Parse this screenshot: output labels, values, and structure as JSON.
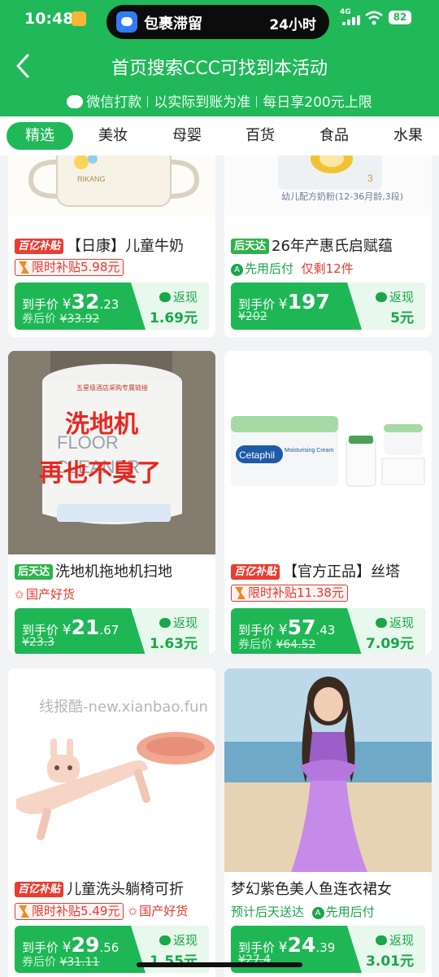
{
  "status": {
    "time": "10:48",
    "island_text": "包裹滞留",
    "island_right": "24小时",
    "network": "4G",
    "battery": "82"
  },
  "header": {
    "title": "首页搜索CCC可找到本活动",
    "subbar": [
      "微信打款",
      "以实际到账为准",
      "每日享200元上限"
    ]
  },
  "tabs": [
    "精选",
    "美妆",
    "母婴",
    "百货",
    "食品",
    "水果"
  ],
  "labels": {
    "subsidy_tag": "百亿补贴",
    "fast_tag": "后天达",
    "final_price": "到手价",
    "after_coupon": "券后价",
    "cashback": "返现",
    "yen": "¥",
    "cashback_unit": "元"
  },
  "products": [
    {
      "title": "【日康】儿童牛奶",
      "tag": "百亿补贴",
      "line2_type": "subsidy",
      "subsidy": "限时补贴5.98元",
      "price_int": "32",
      "price_dec": ".23",
      "old_label": "券后价",
      "old_price": "¥33.92",
      "cashback": "1.69元"
    },
    {
      "title": "26年产惠氏启赋蕴",
      "tag": "后天达",
      "line2_type": "pay_later",
      "pay_later": "先用后付",
      "stock": "仅剩12件",
      "price_int": "197",
      "price_dec": "",
      "old_label": "",
      "old_price": "¥202",
      "cashback": "5元"
    },
    {
      "title": "洗地机拖地机扫地",
      "tag": "后天达",
      "line2_type": "domestic",
      "domestic": "国产好货",
      "price_int": "21",
      "price_dec": ".67",
      "old_label": "",
      "old_price": "¥23.3",
      "cashback": "1.63元",
      "image_text_1": "洗地机",
      "image_text_2": "再也不臭了",
      "image_sub": "FLOOR CLEANER",
      "image_top": "五星级酒店采购专属链接"
    },
    {
      "title": "【官方正品】丝塔",
      "tag": "百亿补贴",
      "line2_type": "subsidy",
      "subsidy": "限时补贴11.38元",
      "price_int": "57",
      "price_dec": ".43",
      "old_label": "券后价",
      "old_price": "¥64.52",
      "cashback": "7.09元",
      "image_brand": "Cetaphil",
      "image_sub": "Moisturising Cream"
    },
    {
      "title": "儿童洗头躺椅可折",
      "tag": "百亿补贴",
      "line2_type": "subsidy_domestic",
      "subsidy": "限时补贴5.49元",
      "domestic": "国产好货",
      "price_int": "29",
      "price_dec": ".56",
      "old_label": "券后价",
      "old_price": "¥31.11",
      "cashback": "1.55元"
    },
    {
      "title": "梦幻紫色美人鱼连衣裙女",
      "tag": "",
      "line2_type": "delivery",
      "delivery": "预计后天送达",
      "pay_later": "先用后付",
      "price_int": "24",
      "price_dec": ".39",
      "old_label": "",
      "old_price": "¥27.4",
      "cashback": "3.01元"
    }
  ],
  "watermark": "线报酷-new.xianbao.fun",
  "colors": {
    "brand_green": "#21b85a",
    "red": "#e33a2e",
    "tag_green": "#2db34a"
  }
}
